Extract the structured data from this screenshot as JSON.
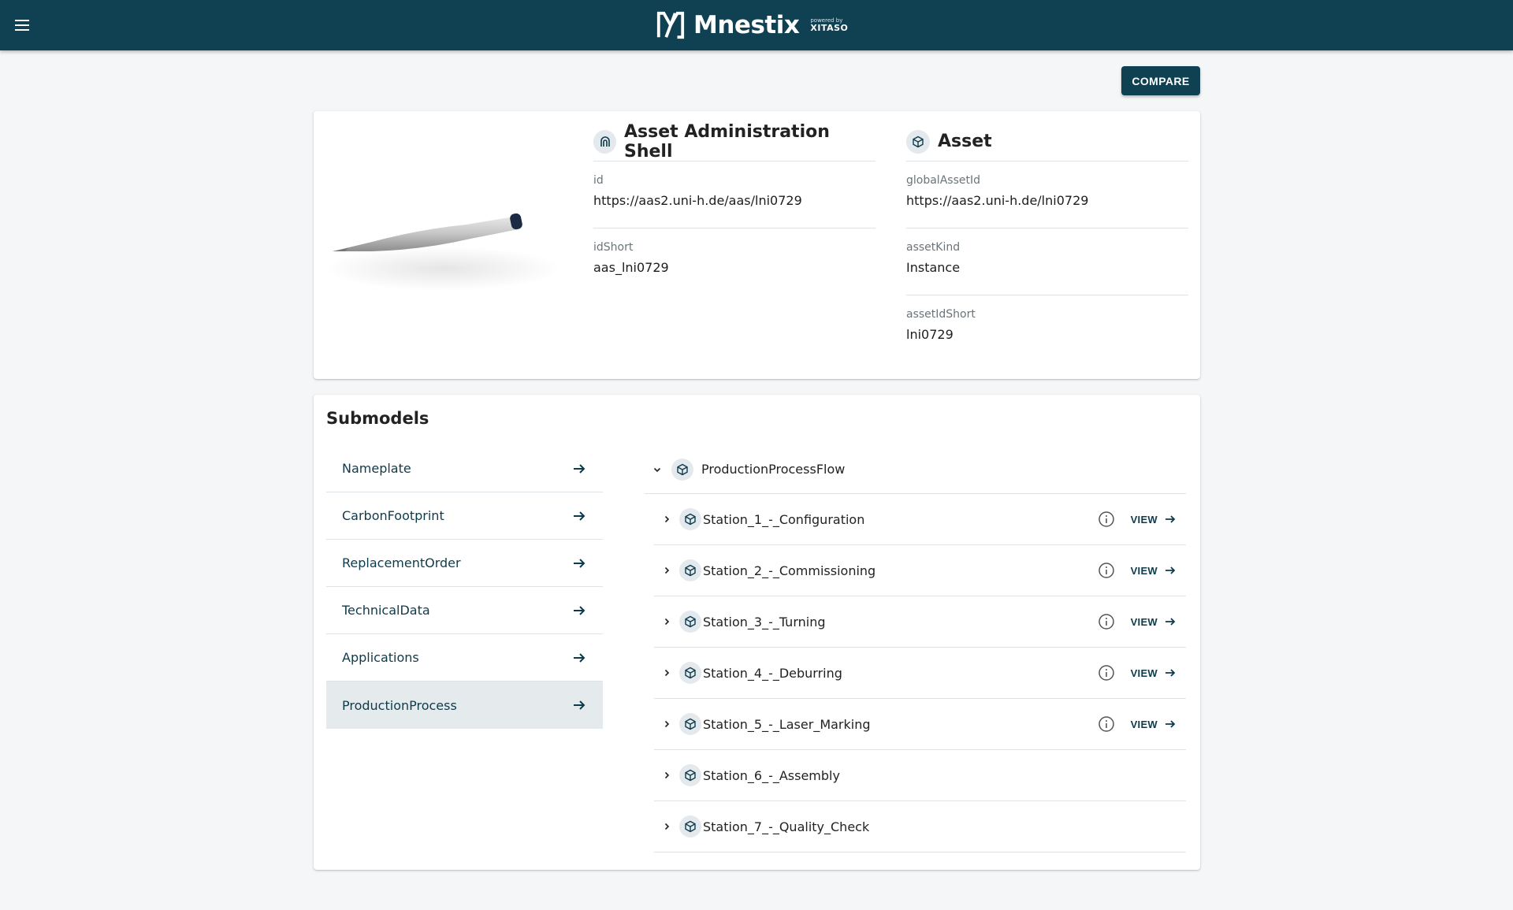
{
  "header": {
    "app_name": "Mnestix",
    "powered_by": "powered by",
    "powered_brand": "XITASO"
  },
  "actions": {
    "compare_label": "COMPARE"
  },
  "aas": {
    "title": "Asset Administration Shell",
    "fields": [
      {
        "label": "id",
        "value": "https://aas2.uni-h.de/aas/lni0729"
      },
      {
        "label": "idShort",
        "value": "aas_lni0729"
      }
    ]
  },
  "asset": {
    "title": "Asset",
    "fields": [
      {
        "label": "globalAssetId",
        "value": "https://aas2.uni-h.de/lni0729"
      },
      {
        "label": "assetKind",
        "value": "Instance"
      },
      {
        "label": "assetIdShort",
        "value": "lni0729"
      }
    ]
  },
  "submodels": {
    "title": "Submodels",
    "items": [
      {
        "label": "Nameplate",
        "selected": false
      },
      {
        "label": "CarbonFootprint",
        "selected": false
      },
      {
        "label": "ReplacementOrder",
        "selected": false
      },
      {
        "label": "TechnicalData",
        "selected": false
      },
      {
        "label": "Applications",
        "selected": false
      },
      {
        "label": "ProductionProcess",
        "selected": true
      }
    ]
  },
  "tree": {
    "root_label": "ProductionProcessFlow",
    "view_label": "VIEW",
    "children": [
      {
        "label": "Station_1_-_Configuration",
        "has_view": true
      },
      {
        "label": "Station_2_-_Commissioning",
        "has_view": true
      },
      {
        "label": "Station_3_-_Turning",
        "has_view": true
      },
      {
        "label": "Station_4_-_Deburring",
        "has_view": true
      },
      {
        "label": "Station_5_-_Laser_Marking",
        "has_view": true
      },
      {
        "label": "Station_6_-_Assembly",
        "has_view": false
      },
      {
        "label": "Station_7_-_Quality_Check",
        "has_view": false
      }
    ]
  },
  "colors": {
    "primary": "#0f4153",
    "selected_bg": "#e5eaed",
    "page_bg": "#f4f6f7"
  }
}
